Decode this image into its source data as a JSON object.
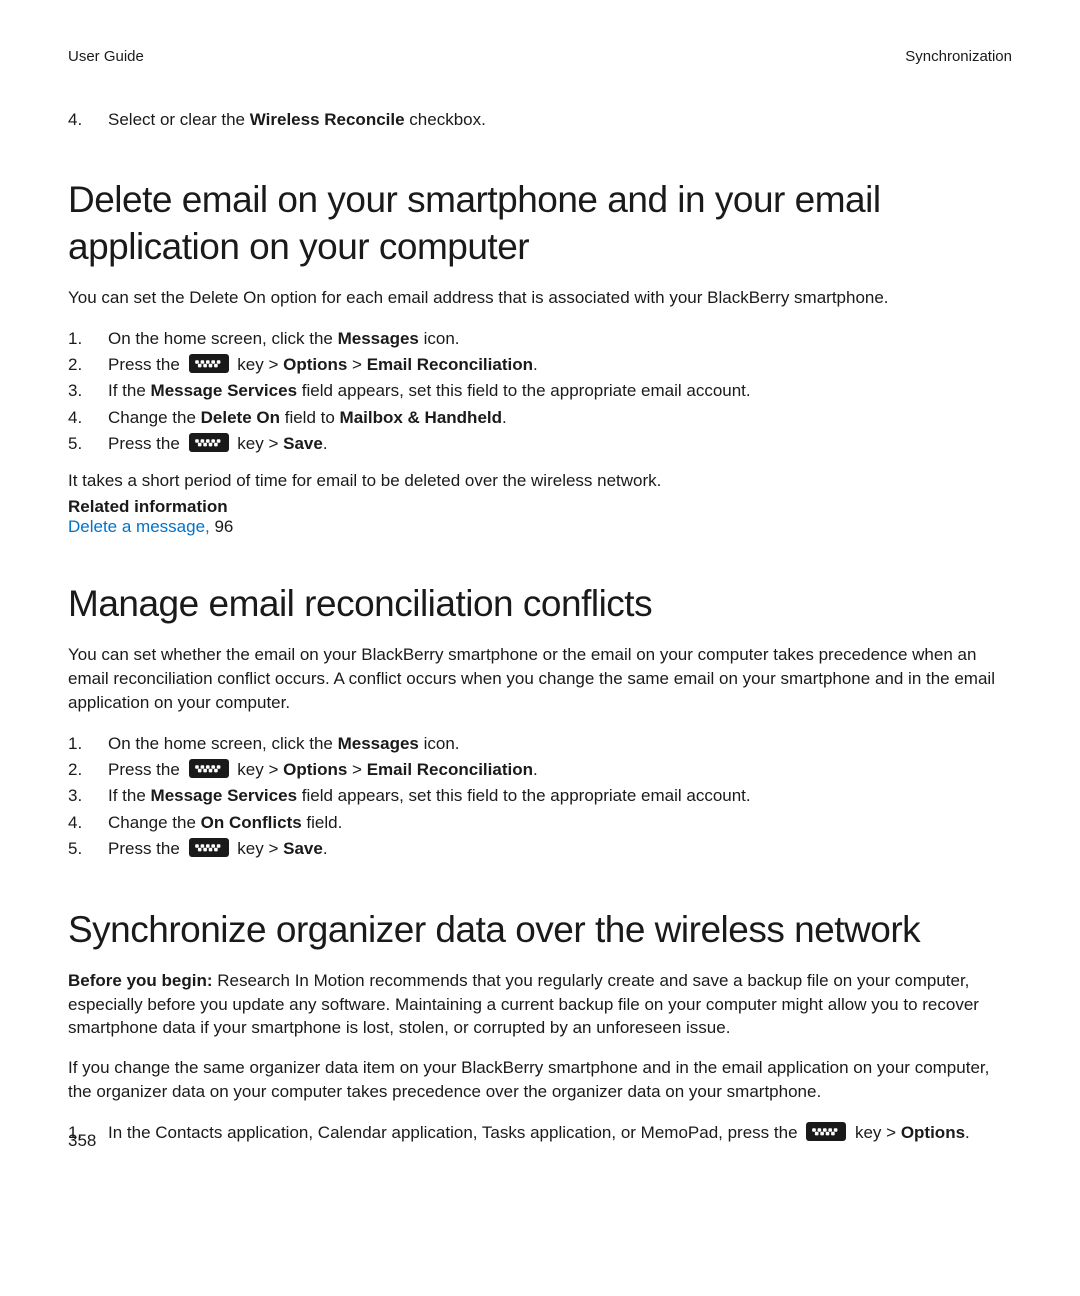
{
  "header": {
    "left": "User Guide",
    "right": "Synchronization"
  },
  "page_number": "358",
  "intro_step": {
    "num": "4.",
    "pre": "Select or clear the ",
    "bold": "Wireless Reconcile",
    "post": " checkbox."
  },
  "sec1": {
    "title": "Delete email on your smartphone and in your email application on your computer",
    "intro": "You can set the Delete On option for each email address that is associated with your BlackBerry smartphone.",
    "steps": {
      "s1": {
        "num": "1.",
        "pre": "On the home screen, click the ",
        "bold": "Messages",
        "post": " icon."
      },
      "s2": {
        "num": "2.",
        "pre": "Press the ",
        "mid": " key > ",
        "b1": "Options",
        "sep": " > ",
        "b2": "Email Reconciliation",
        "post": "."
      },
      "s3": {
        "num": "3.",
        "pre": "If the ",
        "bold": "Message Services",
        "post": " field appears, set this field to the appropriate email account."
      },
      "s4": {
        "num": "4.",
        "pre": "Change the ",
        "b1": "Delete On",
        "mid": " field to ",
        "b2": "Mailbox & Handheld",
        "post": "."
      },
      "s5": {
        "num": "5.",
        "pre": "Press the ",
        "mid": " key > ",
        "b1": "Save",
        "post": "."
      }
    },
    "footer1": "It takes a short period of time for email to be deleted over the wireless network.",
    "related_heading": "Related information",
    "related_link_text": "Delete a message,",
    "related_link_page": " 96"
  },
  "sec2": {
    "title": "Manage email reconciliation conflicts",
    "intro": "You can set whether the email on your BlackBerry smartphone or the email on your computer takes precedence when an email reconciliation conflict occurs. A conflict occurs when you change the same email on your smartphone and in the email application on your computer.",
    "steps": {
      "s1": {
        "num": "1.",
        "pre": "On the home screen, click the ",
        "bold": "Messages",
        "post": " icon."
      },
      "s2": {
        "num": "2.",
        "pre": "Press the ",
        "mid": " key > ",
        "b1": "Options",
        "sep": " > ",
        "b2": "Email Reconciliation",
        "post": "."
      },
      "s3": {
        "num": "3.",
        "pre": "If the ",
        "bold": "Message Services",
        "post": " field appears, set this field to the appropriate email account."
      },
      "s4": {
        "num": "4.",
        "pre": "Change the ",
        "bold": "On Conflicts",
        "post": " field."
      },
      "s5": {
        "num": "5.",
        "pre": "Press the ",
        "mid": " key > ",
        "b1": "Save",
        "post": "."
      }
    }
  },
  "sec3": {
    "title": "Synchronize organizer data over the wireless network",
    "p1_bold": "Before you begin: ",
    "p1_rest": "Research In Motion recommends that you regularly create and save a backup file on your computer, especially before you update any software. Maintaining a current backup file on your computer might allow you to recover smartphone data if your smartphone is lost, stolen, or corrupted by an unforeseen issue.",
    "p2": "If you change the same organizer data item on your BlackBerry smartphone and in the email application on your computer, the organizer data on your computer takes precedence over the organizer data on your smartphone.",
    "steps": {
      "s1": {
        "num": "1.",
        "pre": "In the Contacts application, Calendar application, Tasks application, or MemoPad, press the ",
        "mid": " key > ",
        "b1": "Options",
        "post": "."
      }
    }
  }
}
